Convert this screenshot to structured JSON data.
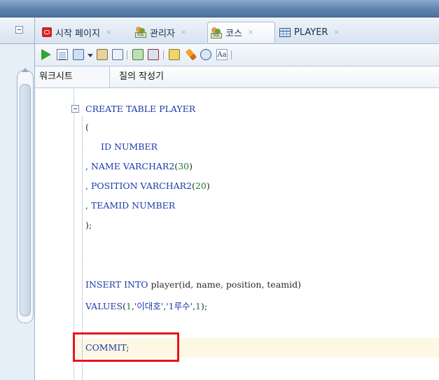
{
  "tabs": [
    {
      "label": "시작 페이지",
      "icon": "oracle-icon",
      "active": false
    },
    {
      "label": "관리자",
      "icon": "sql-connection-icon",
      "active": false
    },
    {
      "label": "코스",
      "icon": "sql-connection-icon",
      "active": true
    },
    {
      "label": "PLAYER",
      "icon": "table-icon",
      "active": false
    }
  ],
  "close_glyph": "×",
  "subtabs": {
    "worksheet": "워크시트",
    "query_builder": "질의 작성기"
  },
  "toolbar": {
    "aa_label": "Aa"
  },
  "connection_icon_text": "SQL",
  "code": {
    "l1_kw": "CREATE TABLE PLAYER",
    "l2": "(",
    "l3a": "ID",
    "l3b": "NUMBER",
    "l4a": ", NAME ",
    "l4b": "VARCHAR2",
    "l4c": "(",
    "l4d": "30",
    "l4e": ")",
    "l5a": ", POSITION ",
    "l5b": "VARCHAR2",
    "l5c": "(",
    "l5d": "20",
    "l5e": ")",
    "l6a": ", TEAMID ",
    "l6b": "NUMBER",
    "l7": ");",
    "l8a": "INSERT INTO",
    "l8b": " player(id, name, position, teamid)",
    "l9a": "VALUES",
    "l9b": "(",
    "l9c": "1",
    "l9d": ",",
    "l9e": "'이대호'",
    "l9f": ",",
    "l9g": "'1루수'",
    "l9h": ",",
    "l9i": "1",
    "l9j": ");",
    "l10a": "COMMIT",
    "l10b": ";"
  },
  "colors": {
    "highlight_box": "#e8141b",
    "keyword": "#1b3aa8",
    "number": "#1f7a2e"
  }
}
